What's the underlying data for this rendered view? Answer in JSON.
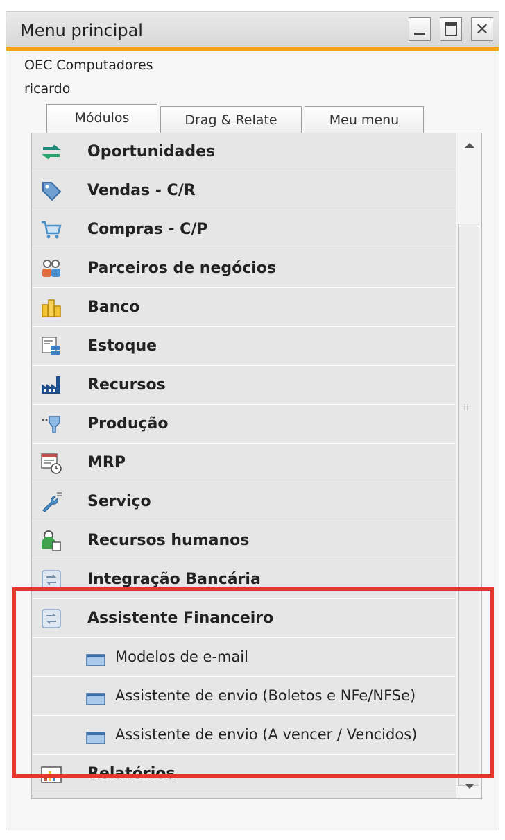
{
  "window": {
    "title": "Menu principal",
    "close_glyph": "✕",
    "company": "OEC Computadores",
    "user": "ricardo"
  },
  "tabs": [
    {
      "label": "Módulos",
      "active": true
    },
    {
      "label": "Drag & Relate",
      "active": false
    },
    {
      "label": "Meu menu",
      "active": false
    }
  ],
  "menu": {
    "items": [
      {
        "label": "Oportunidades",
        "icon": "opportunities-icon"
      },
      {
        "label": "Vendas - C/R",
        "icon": "sales-tag-icon"
      },
      {
        "label": "Compras - C/P",
        "icon": "shopping-cart-icon"
      },
      {
        "label": "Parceiros de negócios",
        "icon": "business-partners-icon"
      },
      {
        "label": "Banco",
        "icon": "bank-coins-icon"
      },
      {
        "label": "Estoque",
        "icon": "inventory-icon"
      },
      {
        "label": "Recursos",
        "icon": "factory-icon"
      },
      {
        "label": "Produção",
        "icon": "production-icon"
      },
      {
        "label": "MRP",
        "icon": "mrp-calendar-icon"
      },
      {
        "label": "Serviço",
        "icon": "service-wrench-icon"
      },
      {
        "label": "Recursos humanos",
        "icon": "human-resources-icon"
      },
      {
        "label": "Integração Bancária",
        "icon": "bank-integration-icon"
      },
      {
        "label": "Assistente Financeiro",
        "icon": "financial-assistant-icon"
      },
      {
        "label": "Modelos de e-mail",
        "icon": "window-form-icon"
      },
      {
        "label": "Assistente de envio (Boletos e NFe/NFSe)",
        "icon": "window-form-icon"
      },
      {
        "label": "Assistente de envio (A vencer / Vencidos)",
        "icon": "window-form-icon"
      },
      {
        "label": "Relatórios",
        "icon": "reports-icon"
      }
    ]
  },
  "colors": {
    "title_accent": "#f2a418",
    "highlight_border": "#e5372b"
  }
}
